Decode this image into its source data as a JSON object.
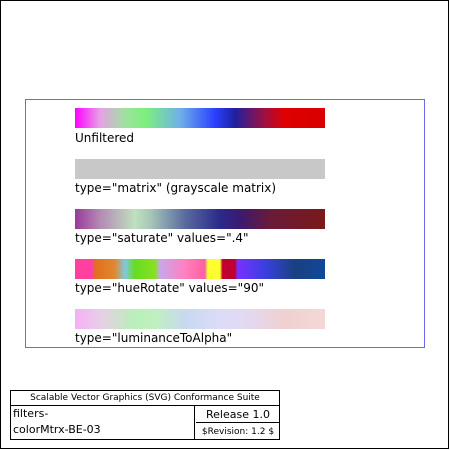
{
  "test_area": {
    "rows": [
      {
        "label": "Unfiltered"
      },
      {
        "label": "type=\"matrix\" (grayscale matrix)"
      },
      {
        "label": "type=\"saturate\" values=\".4\""
      },
      {
        "label": "type=\"hueRotate\" values=\"90\""
      },
      {
        "label": "type=\"luminanceToAlpha\""
      }
    ]
  },
  "legend": {
    "title": "Scalable Vector Graphics (SVG) Conformance Suite",
    "test_name_line1": "filters-",
    "test_name_line2": "colorMtrx-BE-03",
    "release": "Release 1.0",
    "revision": "$Revision: 1.2 $"
  }
}
